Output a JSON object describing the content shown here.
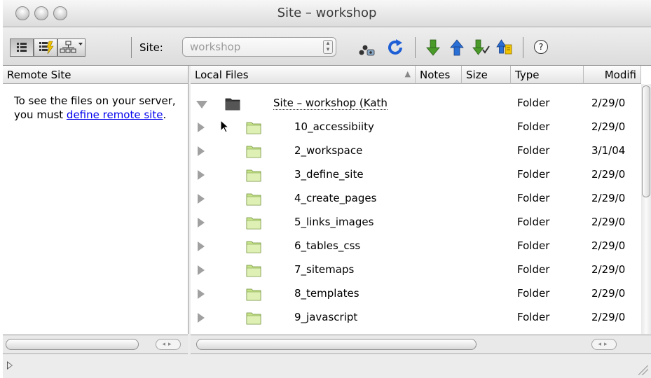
{
  "window": {
    "title": "Site – workshop"
  },
  "toolbar": {
    "site_label": "Site:",
    "site_value": "workshop",
    "help_label": "?"
  },
  "remote_panel": {
    "header": "Remote Site",
    "message_before": "To see the files on your server, you must ",
    "link_text": "define remote site",
    "message_after": "."
  },
  "local_panel": {
    "columns": {
      "name": "Local Files",
      "notes": "Notes",
      "size": "Size",
      "type": "Type",
      "modified": "Modifi"
    },
    "root": {
      "name": "Site – workshop (Kath",
      "type": "Folder",
      "modified": "2/29/0"
    },
    "rows": [
      {
        "name": "10_accessibiity",
        "type": "Folder",
        "modified": "2/29/0"
      },
      {
        "name": "2_workspace",
        "type": "Folder",
        "modified": "3/1/04"
      },
      {
        "name": "3_define_site",
        "type": "Folder",
        "modified": "2/29/0"
      },
      {
        "name": "4_create_pages",
        "type": "Folder",
        "modified": "2/29/0"
      },
      {
        "name": "5_links_images",
        "type": "Folder",
        "modified": "2/29/0"
      },
      {
        "name": "6_tables_css",
        "type": "Folder",
        "modified": "2/29/0"
      },
      {
        "name": "7_sitemaps",
        "type": "Folder",
        "modified": "2/29/0"
      },
      {
        "name": "8_templates",
        "type": "Folder",
        "modified": "2/29/0"
      },
      {
        "name": "9_javascript",
        "type": "Folder",
        "modified": "2/29/0"
      }
    ]
  },
  "colors": {
    "folder_green": "#c7e48a",
    "link_blue": "#0000ee",
    "refresh_blue": "#1f5fd6",
    "arrow_green": "#4a9a2a",
    "arrow_blue": "#2a6fd6"
  }
}
